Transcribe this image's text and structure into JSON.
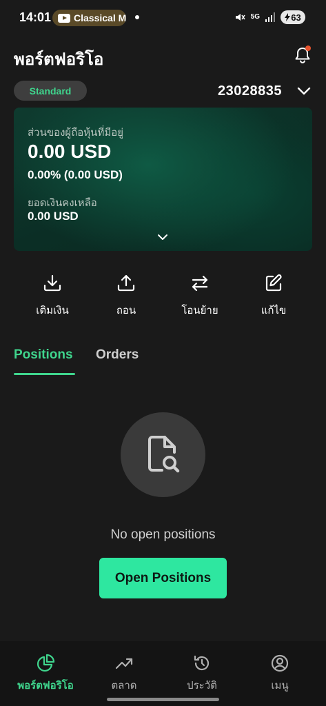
{
  "status_bar": {
    "time": "14:01",
    "media_label": "Classical M",
    "network": "5G",
    "battery": "63"
  },
  "header": {
    "title": "พอร์ตฟอริโอ",
    "account_type": "Standard",
    "account_number": "23028835"
  },
  "card": {
    "equity_label": "ส่วนของผู้ถือหุ้นที่มีอยู่",
    "equity_value": "0.00 USD",
    "equity_change": "0.00% (0.00 USD)",
    "balance_label": "ยอดเงินคงเหลือ",
    "balance_value": "0.00 USD"
  },
  "actions": [
    {
      "label": "เติมเงิน",
      "icon": "download-icon"
    },
    {
      "label": "ถอน",
      "icon": "upload-icon"
    },
    {
      "label": "โอนย้าย",
      "icon": "transfer-icon"
    },
    {
      "label": "แก้ไข",
      "icon": "edit-icon"
    }
  ],
  "tabs": [
    {
      "label": "Positions",
      "active": true
    },
    {
      "label": "Orders",
      "active": false
    }
  ],
  "empty_state": {
    "message": "No open positions",
    "button_label": "Open Positions"
  },
  "bottom_nav": [
    {
      "label": "พอร์ตฟอริโอ",
      "icon": "pie-chart-icon",
      "active": true
    },
    {
      "label": "ตลาด",
      "icon": "trend-up-icon",
      "active": false
    },
    {
      "label": "ประวัติ",
      "icon": "history-icon",
      "active": false
    },
    {
      "label": "เมนู",
      "icon": "user-icon",
      "active": false
    }
  ],
  "colors": {
    "accent": "#3fd58d",
    "button": "#2ee7a0",
    "background": "#1a1a1a",
    "notification_dot": "#e8542e"
  }
}
